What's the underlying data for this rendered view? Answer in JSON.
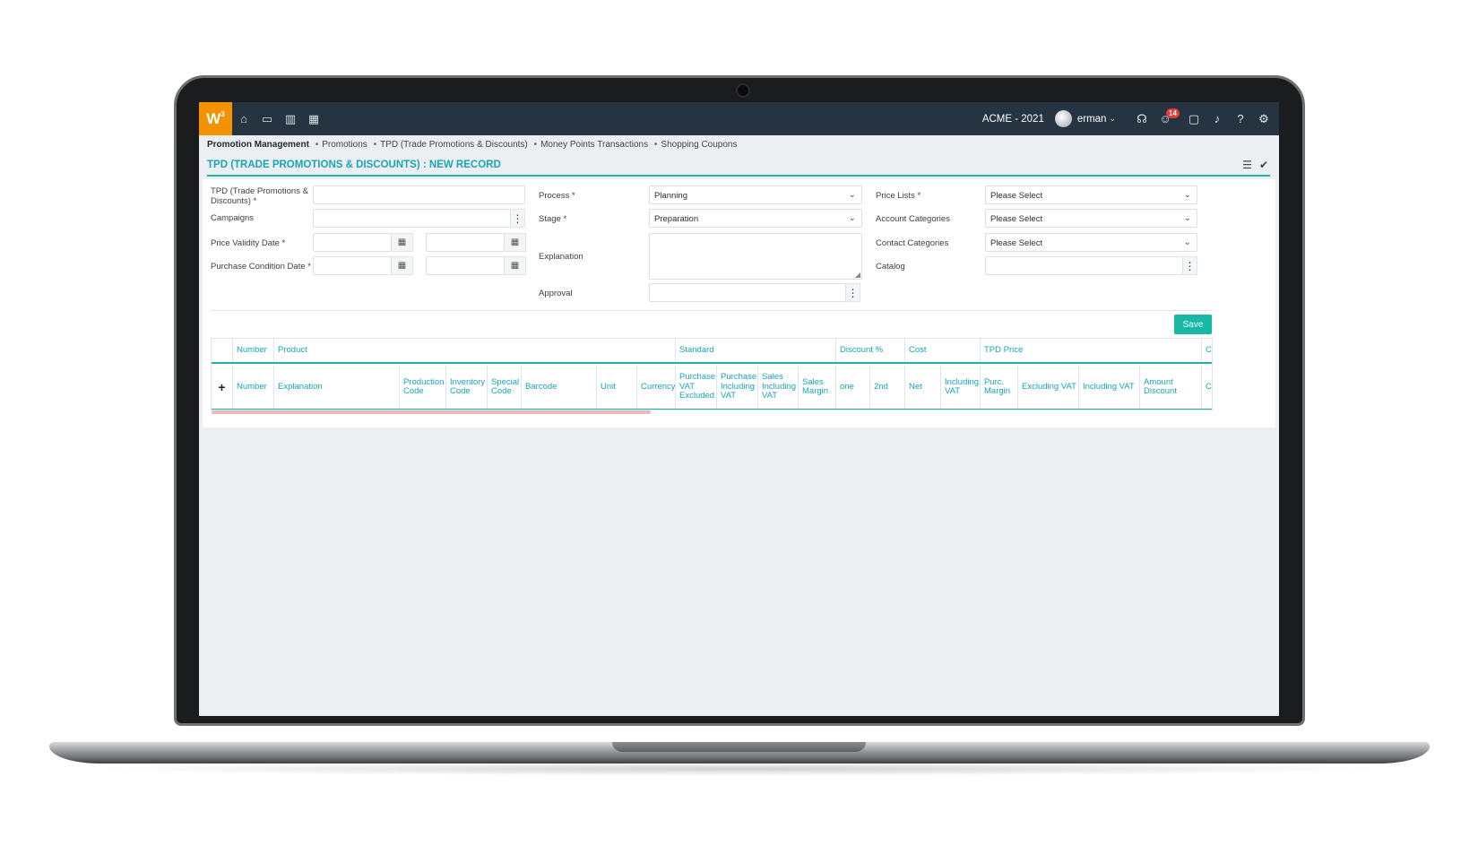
{
  "app": {
    "logo_text": "W",
    "logo_sup": "3",
    "company": "ACME - 2021",
    "user": "erman",
    "notification_count": "14"
  },
  "nav_icons": [
    "home-icon",
    "box-icon",
    "bar-chart-icon",
    "calendar-icon"
  ],
  "breadcrumb": {
    "items": [
      "Promotion Management",
      "Promotions",
      "TPD (Trade Promotions & Discounts)",
      "Money Points Transactions",
      "Shopping Coupons"
    ]
  },
  "page": {
    "title": "TPD (TRADE PROMOTIONS & DISCOUNTS) : NEW RECORD"
  },
  "form": {
    "tpd_label": "TPD (Trade Promotions & Discounts) *",
    "campaigns_label": "Campaigns",
    "price_validity_label": "Price Validity Date *",
    "purchase_condition_label": "Purchase Condition Date *",
    "process_label": "Process *",
    "process_value": "Planning",
    "stage_label": "Stage *",
    "stage_value": "Preparation",
    "explanation_label": "Explanation",
    "approval_label": "Approval",
    "price_lists_label": "Price Lists *",
    "price_lists_value": "Please Select",
    "account_categories_label": "Account Categories",
    "account_categories_value": "Please Select",
    "contact_categories_label": "Contact Categories",
    "contact_categories_value": "Please Select",
    "catalog_label": "Catalog",
    "save_label": "Save"
  },
  "table": {
    "group_headers": [
      "",
      "Number",
      "Product",
      "Standard",
      "Discount %",
      "Cost",
      "TPD Price",
      "Cu"
    ],
    "columns": [
      "+",
      "Number",
      "Explanation",
      "Production Code",
      "Inventory Code",
      "Special Code",
      "Barcode",
      "Unit",
      "Currency",
      "Purchase VAT Excluded",
      "Purchase Including VAT",
      "Sales Including VAT",
      "Sales Margin",
      "one",
      "2nd",
      "Net",
      "Including VAT",
      "Purc. Margin",
      "Excluding VAT",
      "Including VAT",
      "Amount Discount",
      "Cu"
    ]
  }
}
